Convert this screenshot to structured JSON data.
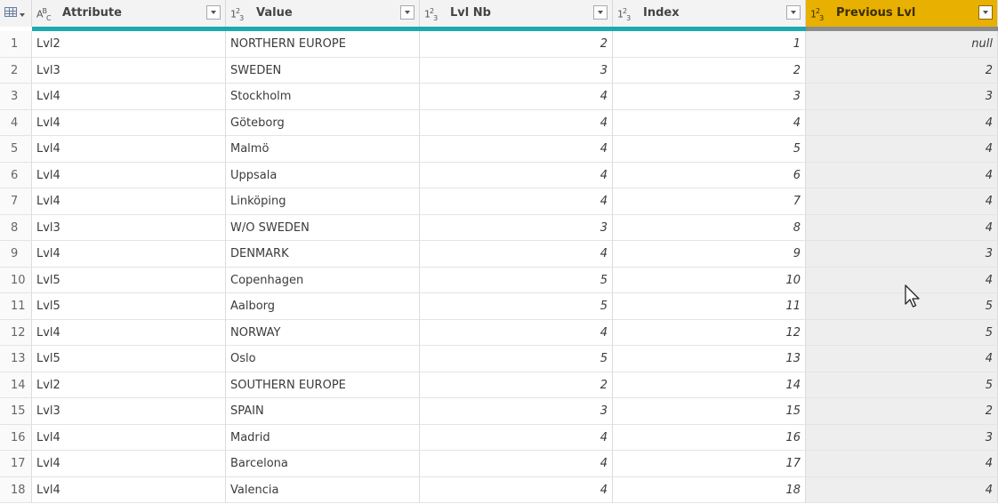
{
  "columns": [
    {
      "type_icon": "ABC",
      "label": "Attribute",
      "kind": "text"
    },
    {
      "type_icon": "123",
      "label": "Value",
      "kind": "text"
    },
    {
      "type_icon": "123",
      "label": "Lvl Nb",
      "kind": "num"
    },
    {
      "type_icon": "123",
      "label": "Index",
      "kind": "num"
    },
    {
      "type_icon": "123",
      "label": "Previous Lvl",
      "kind": "num",
      "selected": true
    }
  ],
  "rows": [
    {
      "n": "1",
      "attribute": "Lvl2",
      "value": "NORTHERN EUROPE",
      "lvl_nb": "2",
      "index": "1",
      "previous_lvl": "null"
    },
    {
      "n": "2",
      "attribute": "Lvl3",
      "value": "SWEDEN",
      "lvl_nb": "3",
      "index": "2",
      "previous_lvl": "2"
    },
    {
      "n": "3",
      "attribute": "Lvl4",
      "value": "Stockholm",
      "lvl_nb": "4",
      "index": "3",
      "previous_lvl": "3"
    },
    {
      "n": "4",
      "attribute": "Lvl4",
      "value": "Göteborg",
      "lvl_nb": "4",
      "index": "4",
      "previous_lvl": "4"
    },
    {
      "n": "5",
      "attribute": "Lvl4",
      "value": "Malmö",
      "lvl_nb": "4",
      "index": "5",
      "previous_lvl": "4"
    },
    {
      "n": "6",
      "attribute": "Lvl4",
      "value": "Uppsala",
      "lvl_nb": "4",
      "index": "6",
      "previous_lvl": "4"
    },
    {
      "n": "7",
      "attribute": "Lvl4",
      "value": "Linköping",
      "lvl_nb": "4",
      "index": "7",
      "previous_lvl": "4"
    },
    {
      "n": "8",
      "attribute": "Lvl3",
      "value": "W/O SWEDEN",
      "lvl_nb": "3",
      "index": "8",
      "previous_lvl": "4"
    },
    {
      "n": "9",
      "attribute": "Lvl4",
      "value": "DENMARK",
      "lvl_nb": "4",
      "index": "9",
      "previous_lvl": "3"
    },
    {
      "n": "10",
      "attribute": "Lvl5",
      "value": "Copenhagen",
      "lvl_nb": "5",
      "index": "10",
      "previous_lvl": "4"
    },
    {
      "n": "11",
      "attribute": "Lvl5",
      "value": "Aalborg",
      "lvl_nb": "5",
      "index": "11",
      "previous_lvl": "5"
    },
    {
      "n": "12",
      "attribute": "Lvl4",
      "value": "NORWAY",
      "lvl_nb": "4",
      "index": "12",
      "previous_lvl": "5"
    },
    {
      "n": "13",
      "attribute": "Lvl5",
      "value": "Oslo",
      "lvl_nb": "5",
      "index": "13",
      "previous_lvl": "4"
    },
    {
      "n": "14",
      "attribute": "Lvl2",
      "value": "SOUTHERN EUROPE",
      "lvl_nb": "2",
      "index": "14",
      "previous_lvl": "5"
    },
    {
      "n": "15",
      "attribute": "Lvl3",
      "value": "SPAIN",
      "lvl_nb": "3",
      "index": "15",
      "previous_lvl": "2"
    },
    {
      "n": "16",
      "attribute": "Lvl4",
      "value": "Madrid",
      "lvl_nb": "4",
      "index": "16",
      "previous_lvl": "3"
    },
    {
      "n": "17",
      "attribute": "Lvl4",
      "value": "Barcelona",
      "lvl_nb": "4",
      "index": "17",
      "previous_lvl": "4"
    },
    {
      "n": "18",
      "attribute": "Lvl4",
      "value": "Valencia",
      "lvl_nb": "4",
      "index": "18",
      "previous_lvl": "4"
    }
  ],
  "colors": {
    "selected_header": "#e8b000",
    "quality_bar": "#1ca9b0",
    "selected_column_bg": "#eeeeee"
  }
}
